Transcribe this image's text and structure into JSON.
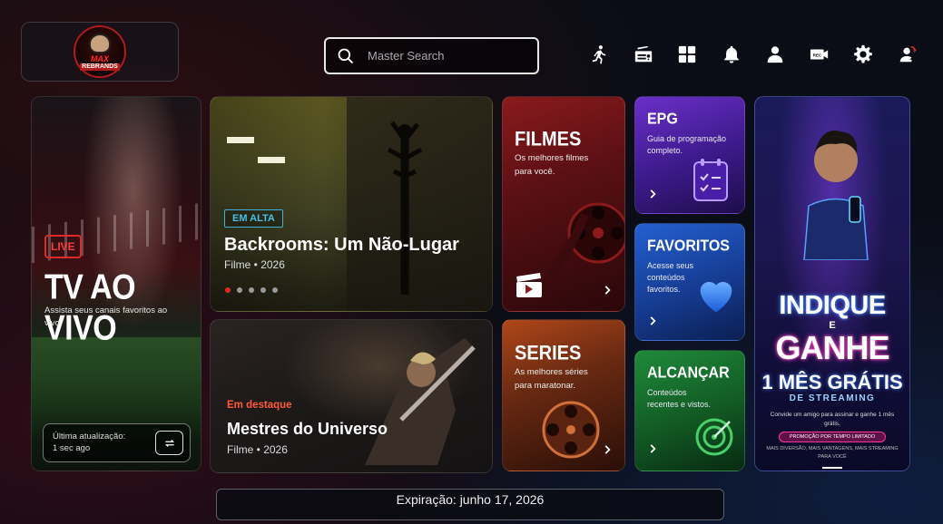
{
  "logo": {
    "line1": "MAX",
    "line2": "REBRANDS"
  },
  "search": {
    "placeholder": "Master Search"
  },
  "top_icons": [
    "running-man-icon",
    "radio-icon",
    "grid-icon",
    "bell-icon",
    "user-icon",
    "record-camera-icon",
    "gear-icon",
    "switch-user-icon"
  ],
  "live_tv": {
    "badge": "LIVE",
    "title": "TV AO VIVO",
    "description": "Assista seus canais favoritos ao vivo.",
    "update_label": "Última atualização:",
    "update_value": "1 sec ago"
  },
  "hero": {
    "tag": "EM ALTA",
    "title": "Backrooms: Um Não-Lugar",
    "subtitle": "Filme • 2026",
    "slide_count": 5,
    "active_slide": 1
  },
  "featured": {
    "tag": "Em destaque",
    "title": "Mestres do Universo",
    "subtitle": "Filme • 2026"
  },
  "filmes": {
    "title": "FILMES",
    "description": "Os melhores filmes para você."
  },
  "series": {
    "title": "SERIES",
    "description": "As melhores séries para maratonar."
  },
  "epg": {
    "title": "EPG",
    "description": "Guia de programação completo."
  },
  "favoritos": {
    "title": "FAVORITOS",
    "description": "Acesse seus conteúdos favoritos."
  },
  "alcancar": {
    "title": "ALCANÇAR",
    "description": "Conteúdos recentes e vistos."
  },
  "promo": {
    "line1": "INDIQUE",
    "line_e": "E",
    "line2": "GANHE",
    "line3": "1 MÊS GRÁTIS",
    "line4": "DE STREAMING",
    "line5": "Convide um amigo para assinar e ganhe 1 mês grátis.",
    "line6": "PROMOÇÃO POR TEMPO LIMITADO",
    "line7": "MAIS DIVERSÃO, MAIS VANTAGENS, MAIS STREAMING PARA VOCÊ"
  },
  "expiry": {
    "text": "Expiração: junho 17, 2026"
  },
  "colors": {
    "accent_red": "#e02a2a",
    "accent_cyan": "#48c0e8",
    "featured_orange": "#ff5a38"
  }
}
